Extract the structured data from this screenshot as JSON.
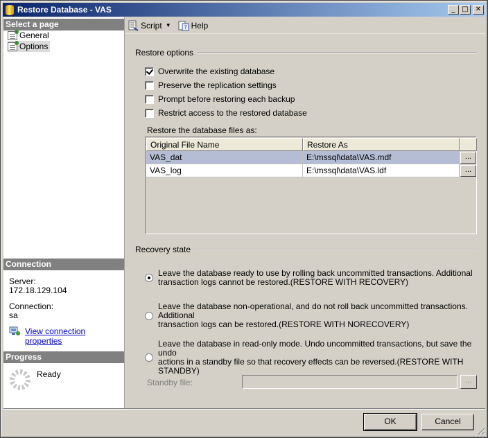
{
  "window": {
    "title": "Restore Database - VAS",
    "minimize_glyph": "_",
    "maximize_glyph": "□",
    "close_glyph": "✕"
  },
  "left_panel": {
    "select_page_header": "Select a page",
    "pages": [
      {
        "label": "General",
        "selected": false
      },
      {
        "label": "Options",
        "selected": true
      }
    ],
    "connection_header": "Connection",
    "server_label": "Server:",
    "server_value": "172.18.129.104",
    "connection_label": "Connection:",
    "connection_value": "sa",
    "view_connection_link": "View connection properties",
    "progress_header": "Progress",
    "progress_status": "Ready"
  },
  "toolbar": {
    "script_label": "Script",
    "help_label": "Help"
  },
  "restore_options": {
    "title": "Restore options",
    "checkboxes": [
      {
        "label": "Overwrite the existing database",
        "checked": true
      },
      {
        "label": "Preserve the replication settings",
        "checked": false
      },
      {
        "label": "Prompt before restoring each backup",
        "checked": false
      },
      {
        "label": "Restrict access to the restored database",
        "checked": false
      }
    ],
    "files_label": "Restore the database files as:",
    "columns": [
      "Original File Name",
      "Restore As"
    ],
    "rows": [
      {
        "original": "VAS_dat",
        "restore_as": "E:\\mssql\\data\\VAS.mdf",
        "selected": true
      },
      {
        "original": "VAS_log",
        "restore_as": "E:\\mssql\\data\\VAS.ldf",
        "selected": false
      }
    ],
    "browse_glyph": "..."
  },
  "recovery_state": {
    "title": "Recovery state",
    "options": [
      {
        "line1": "Leave the database ready to use by rolling back uncommitted transactions. Additional",
        "line2": "transaction logs cannot be restored.(RESTORE WITH RECOVERY)",
        "selected": true
      },
      {
        "line1": "Leave the database non-operational, and do not roll back uncommitted transactions. Additional",
        "line2": "transaction logs can be restored.(RESTORE WITH NORECOVERY)",
        "selected": false
      },
      {
        "line1": "Leave the database in read-only mode. Undo uncommitted transactions, but save the undo",
        "line2": "actions in a standby file so that recovery effects can be reversed.(RESTORE WITH STANDBY)",
        "selected": false
      }
    ],
    "standby_label": "Standby file:",
    "standby_value": "",
    "standby_browse_glyph": "..."
  },
  "buttons": {
    "ok": "OK",
    "cancel": "Cancel"
  }
}
